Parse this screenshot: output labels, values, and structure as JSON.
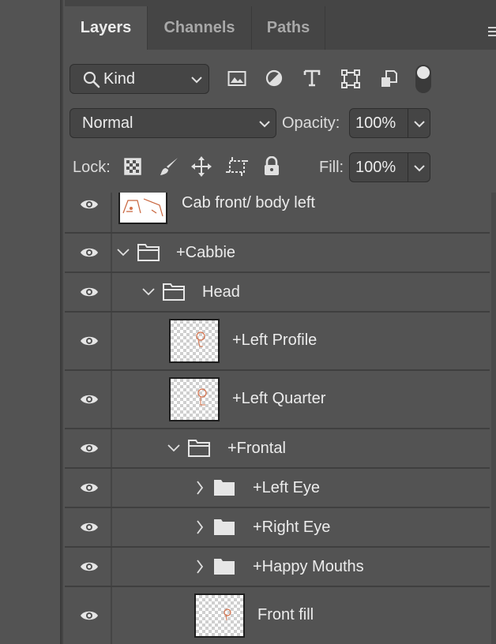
{
  "tabs": {
    "layers": "Layers",
    "channels": "Channels",
    "paths": "Paths"
  },
  "filter": {
    "kind_label": "Kind",
    "icons": [
      "search-icon",
      "image-filter-icon",
      "adjustment-filter-icon",
      "type-filter-icon",
      "shape-filter-icon",
      "smart-object-filter-icon",
      "filter-toggle"
    ]
  },
  "blend": {
    "mode": "Normal",
    "opacity_label": "Opacity:",
    "opacity_value": "100%"
  },
  "lock": {
    "label": "Lock:",
    "icons": [
      "lock-transparent-icon",
      "lock-image-icon",
      "lock-position-icon",
      "lock-artboard-icon",
      "lock-all-icon"
    ],
    "fill_label": "Fill:",
    "fill_value": "100%"
  },
  "layers": [
    {
      "name": "Cab front/ body left",
      "type": "layer",
      "visible": true
    },
    {
      "name": "+Cabbie",
      "type": "group",
      "expanded": true,
      "visible": true
    },
    {
      "name": "Head",
      "type": "group",
      "expanded": true,
      "visible": true
    },
    {
      "name": "+Left Profile",
      "type": "layer",
      "visible": true
    },
    {
      "name": "+Left Quarter",
      "type": "layer",
      "visible": true
    },
    {
      "name": "+Frontal",
      "type": "group",
      "expanded": true,
      "visible": true
    },
    {
      "name": "+Left Eye",
      "type": "group",
      "expanded": false,
      "visible": true
    },
    {
      "name": "+Right Eye",
      "type": "group",
      "expanded": false,
      "visible": true
    },
    {
      "name": "+Happy Mouths",
      "type": "group",
      "expanded": false,
      "visible": true
    },
    {
      "name": "Front fill",
      "type": "layer",
      "visible": true
    }
  ],
  "colors": {
    "panel_bg": "#535353",
    "tab_bar_bg": "#454545",
    "text": "#ececec"
  }
}
